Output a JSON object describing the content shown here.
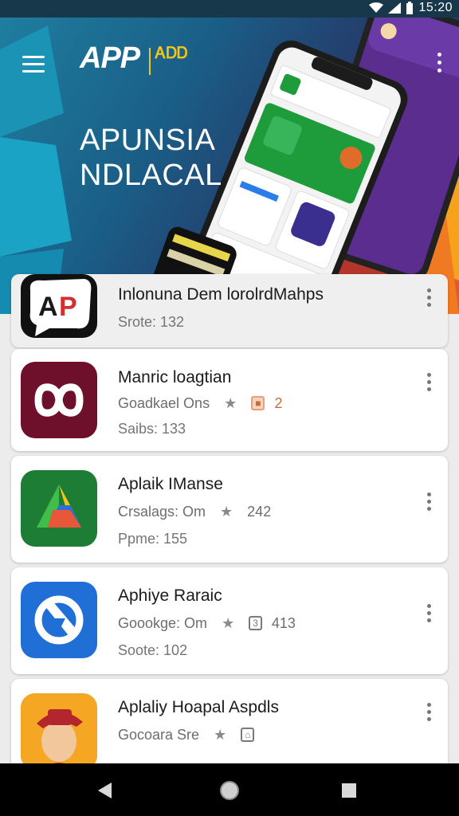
{
  "status": {
    "time": "15:20"
  },
  "header": {
    "brand": "APP",
    "brand_tag": "ᎪᎠᎠ",
    "headline_line1": "APUNSIA",
    "headline_line2": "NDLACAL"
  },
  "apps": [
    {
      "title": "Inlonuna Dem lorolrdMahps",
      "meta": "",
      "rating": "",
      "sub": "Srote: 132"
    },
    {
      "title": "Manric loagtian",
      "meta": "Goadkael Ons",
      "badge": "",
      "rating": "2",
      "sub": "Saibs: 133"
    },
    {
      "title": "Aplaik IManse",
      "meta": "Crsalags: Om",
      "badge": "",
      "rating": "242",
      "sub": "Ppme: 155"
    },
    {
      "title": "Aphiye Raraic",
      "meta": "Goookge: Om",
      "badge": "3",
      "rating": "413",
      "sub": "Soote: 102"
    },
    {
      "title": "Aplaliy Hoapal Aspdls",
      "meta": "Gocoara Sre",
      "badge": "⌂",
      "rating": "",
      "sub": ""
    }
  ],
  "colors": {
    "accent_green": "#1e9b3a",
    "accent_blue": "#1f6fd6",
    "maroon": "#6e0f2c",
    "orange": "#f08a1e"
  }
}
